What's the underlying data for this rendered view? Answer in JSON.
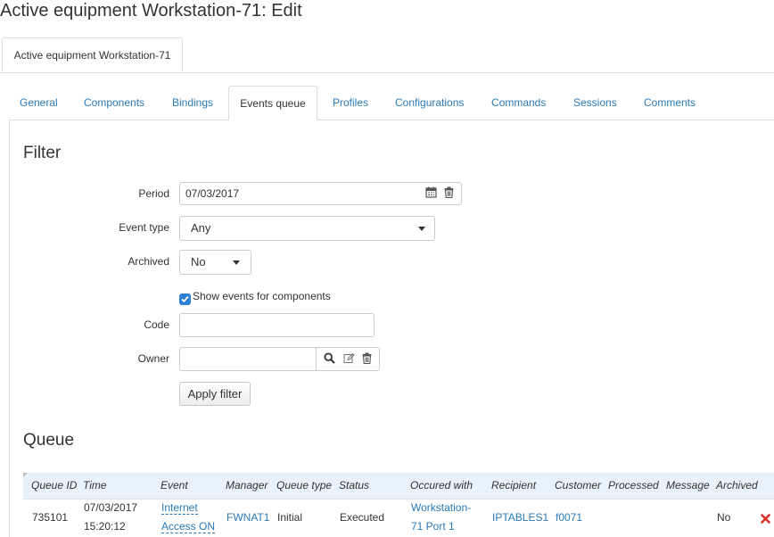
{
  "header": {
    "title": "Active equipment Workstation-71: Edit"
  },
  "outer_tab": {
    "label": "Active equipment Workstation-71"
  },
  "tabs": [
    {
      "label": "General"
    },
    {
      "label": "Components"
    },
    {
      "label": "Bindings"
    },
    {
      "label": "Events queue"
    },
    {
      "label": "Profiles"
    },
    {
      "label": "Configurations"
    },
    {
      "label": "Commands"
    },
    {
      "label": "Sessions"
    },
    {
      "label": "Comments"
    }
  ],
  "active_tab": "Events queue",
  "filter": {
    "heading": "Filter",
    "period_label": "Period",
    "period_value": "07/03/2017",
    "event_type_label": "Event type",
    "event_type_value": "Any",
    "archived_label": "Archived",
    "archived_value": "No",
    "show_components_label": "Show events for components",
    "show_components_checked": true,
    "code_label": "Code",
    "code_value": "",
    "owner_label": "Owner",
    "owner_value": "",
    "apply_label": "Apply filter"
  },
  "queue": {
    "heading": "Queue",
    "columns": [
      "Queue ID",
      "Time",
      "Event",
      "Manager",
      "Queue type",
      "Status",
      "Occured with",
      "Recipient",
      "Customer",
      "Processed",
      "Message",
      "Archived"
    ],
    "rows": [
      {
        "queue_id": "735101",
        "time_date": "07/03/2017",
        "time_clock": "15:20:12",
        "event_line1": "Internet",
        "event_line2": "Access ON",
        "manager": "FWNAT1",
        "queue_type": "Initial",
        "status": "Executed",
        "occured_line1": "Workstation-",
        "occured_line2": "71 Port 1",
        "recipient": "IPTABLES1",
        "customer": "f0071",
        "processed": "",
        "message": "",
        "archived": "No"
      }
    ]
  },
  "colors": {
    "link": "#2a7ab8",
    "header_row": "#e8f2fa",
    "checkbox": "#2d7fd6",
    "delete": "#d9302c"
  }
}
